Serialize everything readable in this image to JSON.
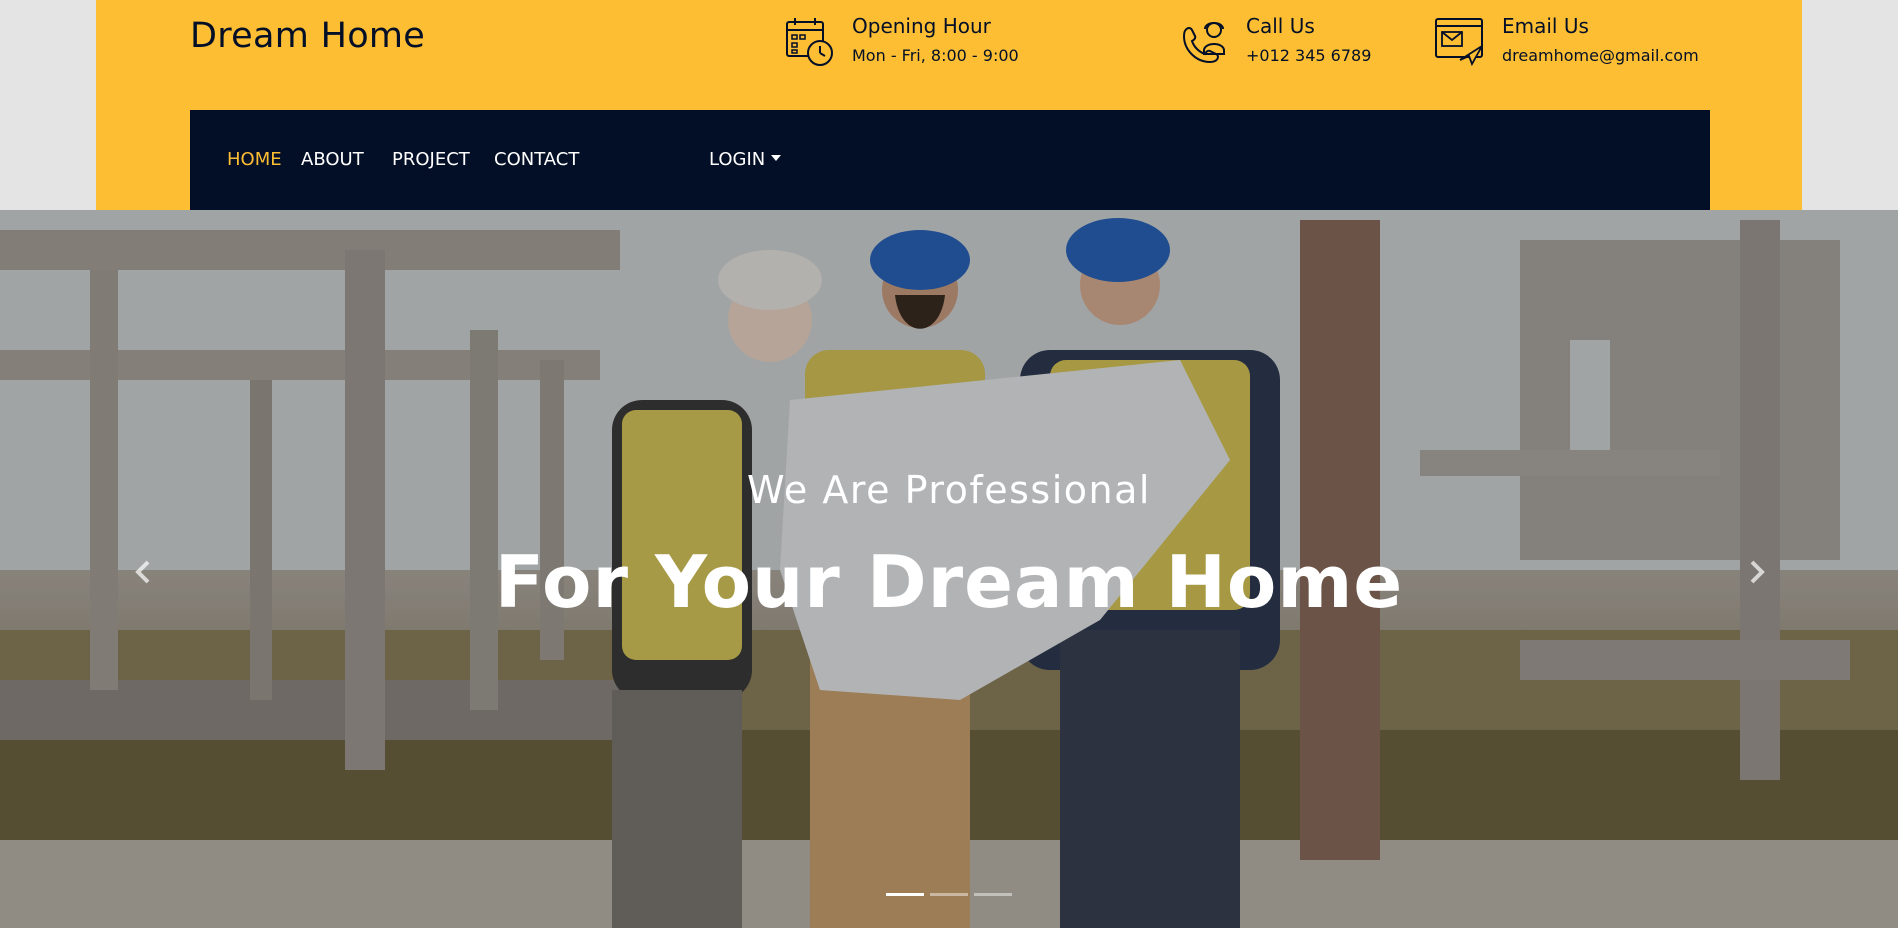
{
  "brand": "Dream Home",
  "header_info": {
    "hours": {
      "title": "Opening Hour",
      "detail": "Mon - Fri, 8:00 - 9:00",
      "icon": "calendar-clock-icon"
    },
    "call": {
      "title": "Call Us",
      "detail": "+012 345 6789",
      "icon": "support-agent-icon"
    },
    "email": {
      "title": "Email Us",
      "detail": "dreamhome@gmail.com",
      "icon": "email-send-icon"
    }
  },
  "nav": {
    "home": "HOME",
    "about": "ABOUT",
    "project": "PROJECT",
    "contact": "CONTACT",
    "login": "LOGIN"
  },
  "hero": {
    "subtitle": "We Are Professional",
    "title": "For Your Dream Home",
    "prev_icon": "chevron-left-icon",
    "next_icon": "chevron-right-icon",
    "slides_count": 3,
    "active_slide": 1
  },
  "colors": {
    "accent": "#fdbe33",
    "navy": "#030f27",
    "white": "#ffffff"
  }
}
